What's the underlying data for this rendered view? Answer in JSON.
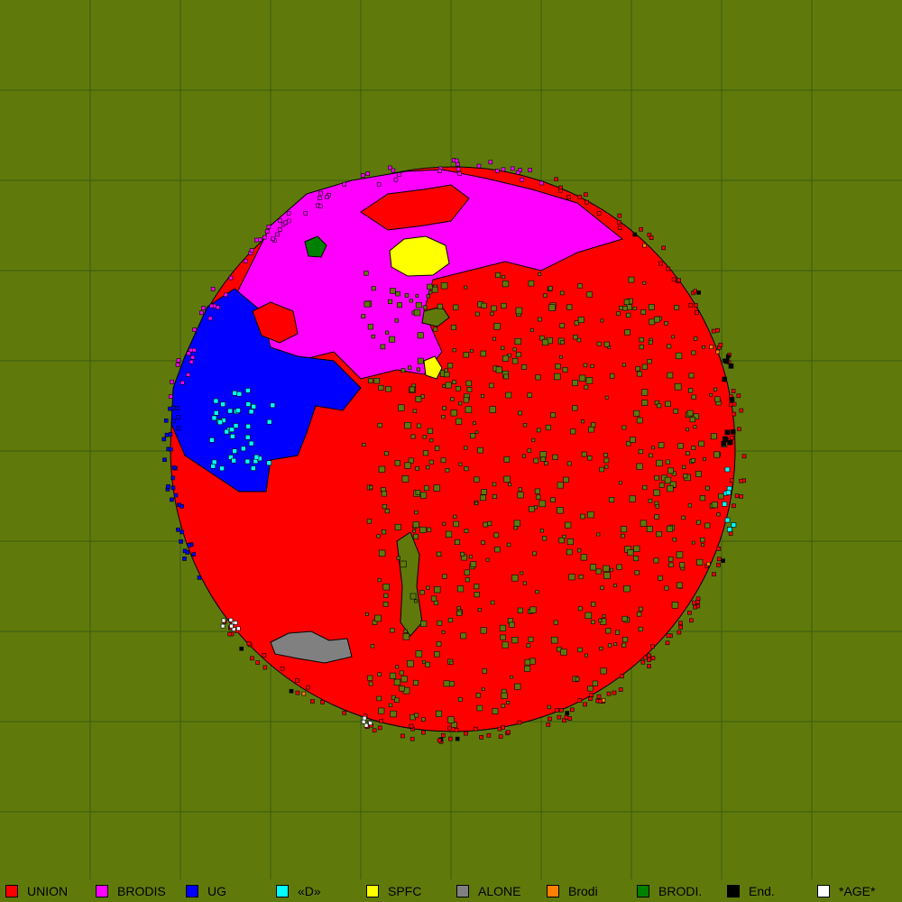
{
  "map": {
    "background_color": "#5f7a0b",
    "grid_color": "#3b5a12",
    "free_cell_color": "#5f7a0b"
  },
  "legend": [
    {
      "label": "UNION",
      "color": "#ff0000"
    },
    {
      "label": "BRODIS",
      "color": "#ff00ff"
    },
    {
      "label": "UG",
      "color": "#0000ff"
    },
    {
      "label": "«D»",
      "color": "#00ffff"
    },
    {
      "label": "SPFC",
      "color": "#ffff00"
    },
    {
      "label": "ALONE",
      "color": "#808080"
    },
    {
      "label": "Brodi",
      "color": "#ff8000"
    },
    {
      "label": "BRODI.",
      "color": "#008000"
    },
    {
      "label": "End.",
      "color": "#000000"
    },
    {
      "label": "*AGE*",
      "color": "#ffffff"
    }
  ]
}
